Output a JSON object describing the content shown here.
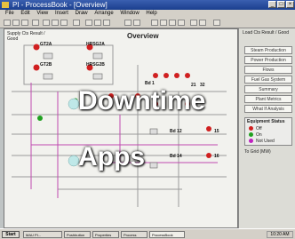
{
  "window": {
    "title": "PI - ProcessBook - [Overview]"
  },
  "menu": [
    "File",
    "Edit",
    "View",
    "Insert",
    "Draw",
    "Arrange",
    "Window",
    "Help"
  ],
  "canvas": {
    "left_header": "Supply Cts Result / Good",
    "title": "Overview",
    "right_header": "Load Cts Result / Good",
    "equipment": [
      "GT2A",
      "HRSG2A",
      "GT2B",
      "HRSG2B",
      "Bd 1",
      "Bd 12",
      "Bd 14"
    ],
    "status_values": [
      "21",
      "32",
      "15",
      "16"
    ]
  },
  "sidebar": {
    "buttons": [
      "Steam Production",
      "Power Production",
      "Flows",
      "Fuel Gas System",
      "Summary",
      "Plant Metrics",
      "What If Analysis"
    ],
    "legend_title": "Equipment Status",
    "legend": [
      {
        "label": "Off",
        "color": "#d02020"
      },
      {
        "label": "On",
        "color": "#20a020"
      },
      {
        "label": "Not Used",
        "color": "#c020c0"
      }
    ],
    "footer": "To Grid (MW)"
  },
  "taskbar": {
    "start": "Start",
    "tasks": [
      "MAU PI...",
      "Pushbutton",
      "Properties",
      "Process",
      "ProcessBook"
    ],
    "clock": "10:20 AM"
  },
  "overlay": {
    "line1": "Downtime",
    "line2": "Apps"
  }
}
